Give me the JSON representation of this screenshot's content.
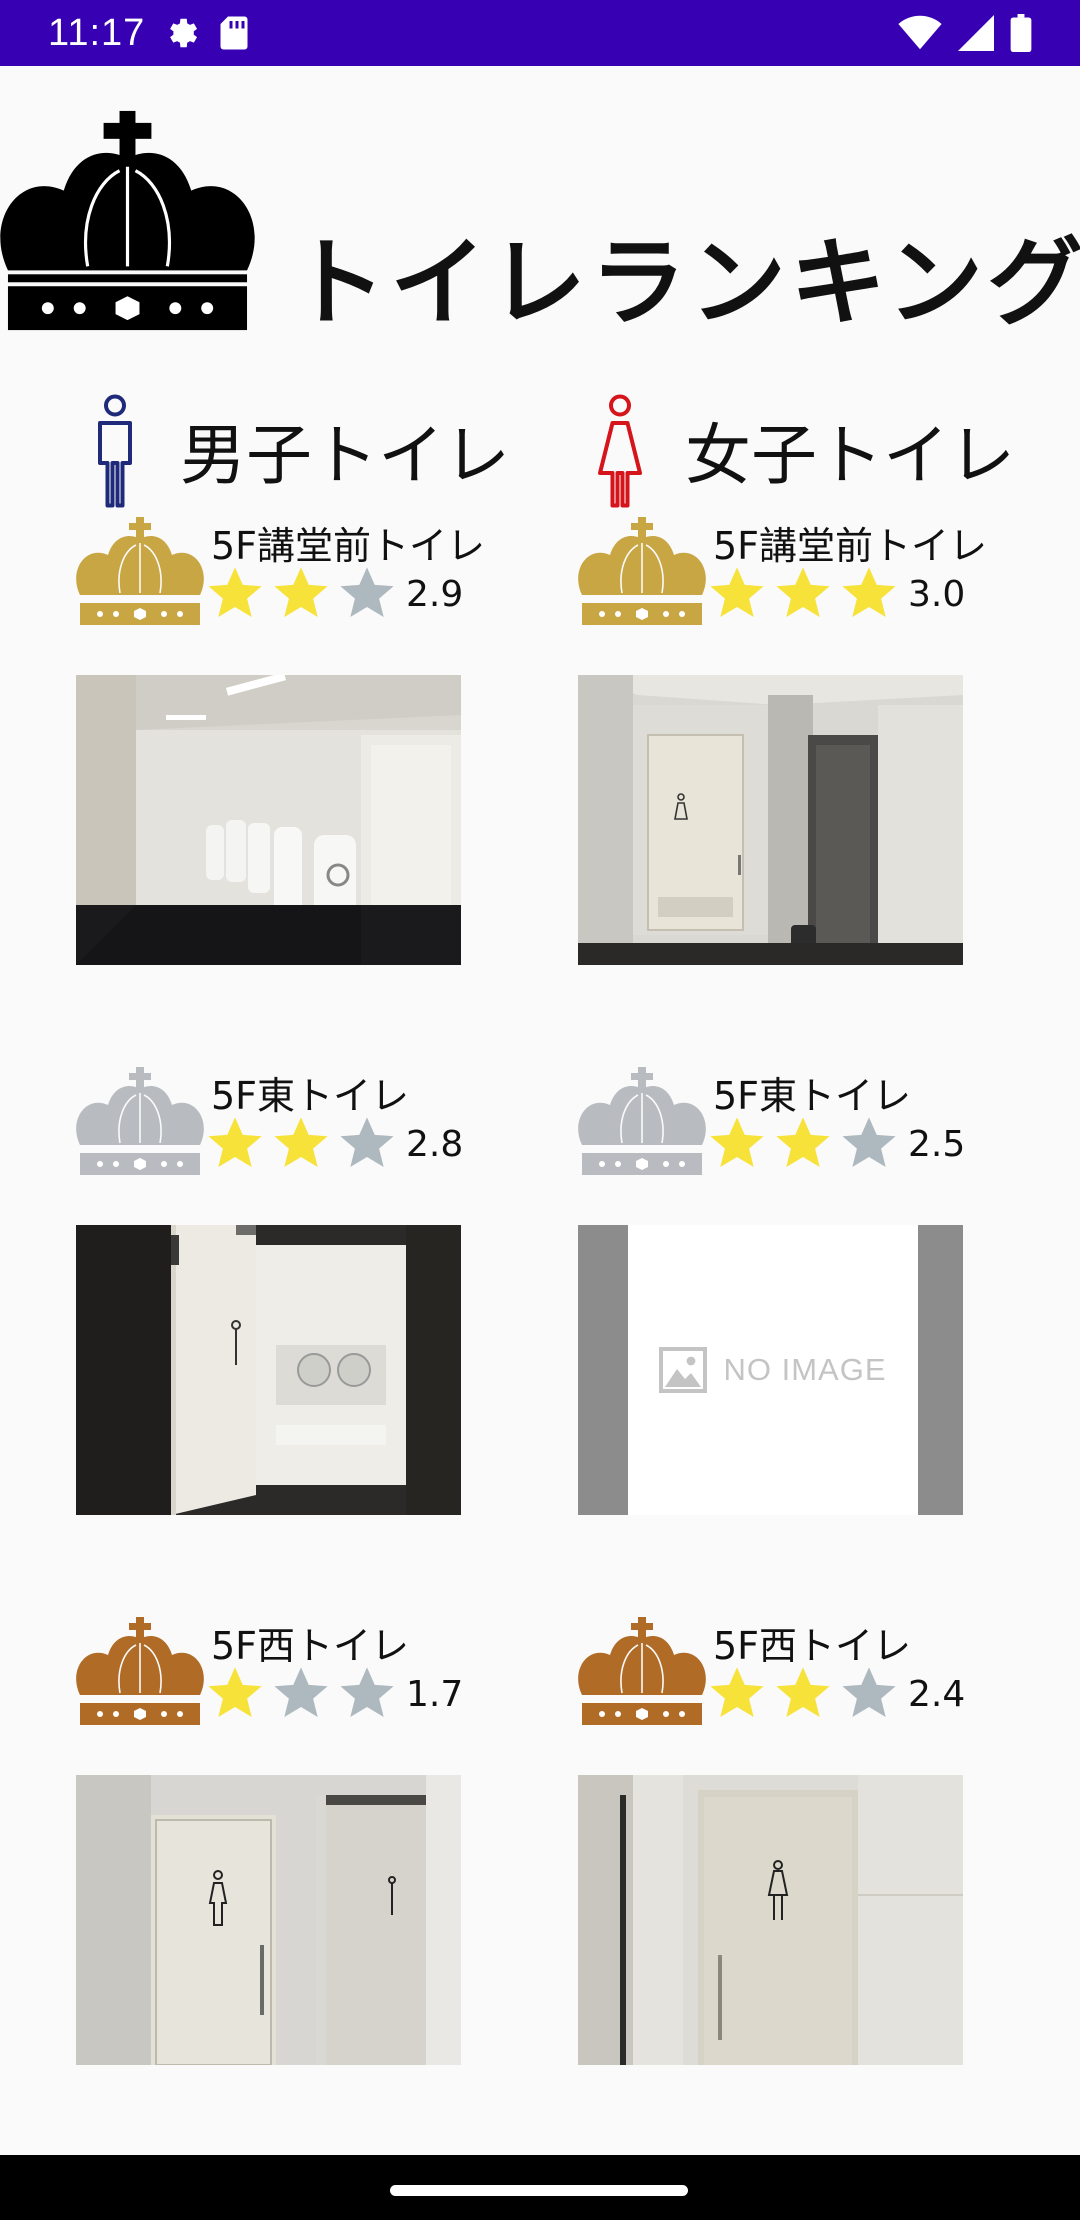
{
  "status_bar": {
    "time": "11:17",
    "left_icons": [
      "settings-icon",
      "sd-card-icon"
    ],
    "right_icons": [
      "wifi-icon",
      "signal-icon",
      "battery-icon"
    ]
  },
  "header": {
    "title": "トイレランキング",
    "icon": "crown-icon"
  },
  "columns": {
    "male": {
      "label": "男子トイレ",
      "icon": "male-person-icon",
      "color": "#1f2a7a"
    },
    "female": {
      "label": "女子トイレ",
      "icon": "female-person-icon",
      "color": "#d6141c"
    }
  },
  "colors": {
    "gold": "#c9a644",
    "silver": "#b8bcc1",
    "bronze": "#b06c26",
    "star_filled": "#f7e23a",
    "star_empty": "#aeb9bf",
    "accent": "#3700b3"
  },
  "male_rankings": [
    {
      "rank": 1,
      "crown": "gold",
      "name": "5F講堂前トイレ",
      "rating": 2.9,
      "score": "2.9",
      "stars_filled": 2,
      "photo": "urinal-room"
    },
    {
      "rank": 2,
      "crown": "silver",
      "name": "5F東トイレ",
      "rating": 2.8,
      "score": "2.8",
      "stars_filled": 2,
      "photo": "sink-room"
    },
    {
      "rank": 3,
      "crown": "bronze",
      "name": "5F西トイレ",
      "rating": 1.7,
      "score": "1.7",
      "stars_filled": 1,
      "photo": "two-doors"
    }
  ],
  "female_rankings": [
    {
      "rank": 1,
      "crown": "gold",
      "name": "5F講堂前トイレ",
      "rating": 3.0,
      "score": "3.0",
      "stars_filled": 3,
      "photo": "hallway-door"
    },
    {
      "rank": 2,
      "crown": "silver",
      "name": "5F東トイレ",
      "rating": 2.5,
      "score": "2.5",
      "stars_filled": 2,
      "photo": "no-image",
      "no_image_text": "NO IMAGE"
    },
    {
      "rank": 3,
      "crown": "bronze",
      "name": "5F西トイレ",
      "rating": 2.4,
      "score": "2.4",
      "stars_filled": 2,
      "photo": "single-door"
    }
  ]
}
